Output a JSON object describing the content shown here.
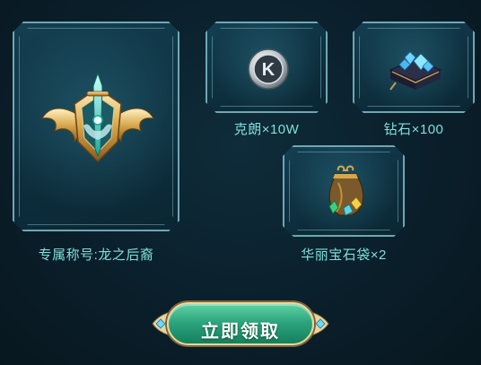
{
  "rewards": {
    "title_badge": {
      "icon": "dragon-crest-badge-icon",
      "label": "专属称号:龙之后裔"
    },
    "coins": {
      "icon": "k-coin-icon",
      "label": "克朗×10W"
    },
    "diamonds": {
      "icon": "gem-chest-icon",
      "label": "钻石×100"
    },
    "gem_bag": {
      "icon": "gem-bag-icon",
      "label": "华丽宝石袋×2"
    }
  },
  "claim_button": {
    "label": "立即领取"
  },
  "colors": {
    "card_border": "#6fa7b2",
    "caption_text": "#7fe0dc",
    "button_green": "#2da57d",
    "button_gold": "#e9d69e"
  }
}
